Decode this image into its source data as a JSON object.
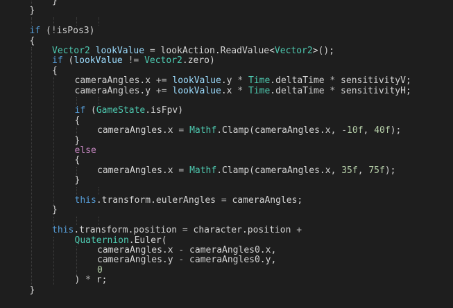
{
  "editor": {
    "language": "C#",
    "theme_colors": {
      "background": "#1e1e1e",
      "plain": "#d4d4d4",
      "keyword": "#569cd6",
      "type": "#4ec9b0",
      "variable": "#9cdcfe",
      "number": "#b5cea8",
      "operator": "#b4b4b4",
      "control": "#c586c0",
      "indent_guide": "#404040"
    },
    "lines": [
      {
        "indent": 2,
        "tokens": [
          {
            "t": "}",
            "c": "p"
          }
        ]
      },
      {
        "indent": 1,
        "tokens": [
          {
            "t": "}",
            "c": "p"
          }
        ]
      },
      {
        "indent": 0,
        "tokens": []
      },
      {
        "indent": 1,
        "tokens": [
          {
            "t": "if",
            "c": "kw"
          },
          {
            "t": " (",
            "c": "p"
          },
          {
            "t": "!",
            "c": "op"
          },
          {
            "t": "isPos3",
            "c": "p"
          },
          {
            "t": ")",
            "c": "p"
          }
        ]
      },
      {
        "indent": 1,
        "tokens": [
          {
            "t": "{",
            "c": "p"
          }
        ]
      },
      {
        "indent": 2,
        "tokens": [
          {
            "t": "Vector2",
            "c": "ty"
          },
          {
            "t": " ",
            "c": "p"
          },
          {
            "t": "lookValue",
            "c": "va"
          },
          {
            "t": " ",
            "c": "p"
          },
          {
            "t": "=",
            "c": "op"
          },
          {
            "t": " lookAction.ReadValue<",
            "c": "p"
          },
          {
            "t": "Vector2",
            "c": "ty"
          },
          {
            "t": ">();",
            "c": "p"
          }
        ]
      },
      {
        "indent": 2,
        "tokens": [
          {
            "t": "if",
            "c": "kw"
          },
          {
            "t": " (",
            "c": "p"
          },
          {
            "t": "lookValue",
            "c": "va"
          },
          {
            "t": " ",
            "c": "p"
          },
          {
            "t": "!=",
            "c": "op"
          },
          {
            "t": " ",
            "c": "p"
          },
          {
            "t": "Vector2",
            "c": "ty"
          },
          {
            "t": ".zero)",
            "c": "p"
          }
        ]
      },
      {
        "indent": 2,
        "tokens": [
          {
            "t": "{",
            "c": "p"
          }
        ]
      },
      {
        "indent": 3,
        "tokens": [
          {
            "t": "cameraAngles.x ",
            "c": "p"
          },
          {
            "t": "+=",
            "c": "op"
          },
          {
            "t": " ",
            "c": "p"
          },
          {
            "t": "lookValue",
            "c": "va"
          },
          {
            "t": ".y ",
            "c": "p"
          },
          {
            "t": "*",
            "c": "op"
          },
          {
            "t": " ",
            "c": "p"
          },
          {
            "t": "Time",
            "c": "ty"
          },
          {
            "t": ".deltaTime ",
            "c": "p"
          },
          {
            "t": "*",
            "c": "op"
          },
          {
            "t": " sensitivityV;",
            "c": "p"
          }
        ]
      },
      {
        "indent": 3,
        "tokens": [
          {
            "t": "cameraAngles.y ",
            "c": "p"
          },
          {
            "t": "+=",
            "c": "op"
          },
          {
            "t": " ",
            "c": "p"
          },
          {
            "t": "lookValue",
            "c": "va"
          },
          {
            "t": ".x ",
            "c": "p"
          },
          {
            "t": "*",
            "c": "op"
          },
          {
            "t": " ",
            "c": "p"
          },
          {
            "t": "Time",
            "c": "ty"
          },
          {
            "t": ".deltaTime ",
            "c": "p"
          },
          {
            "t": "*",
            "c": "op"
          },
          {
            "t": " sensitivityH;",
            "c": "p"
          }
        ]
      },
      {
        "indent": 0,
        "tokens": []
      },
      {
        "indent": 3,
        "tokens": [
          {
            "t": "if",
            "c": "kw"
          },
          {
            "t": " (",
            "c": "p"
          },
          {
            "t": "GameState",
            "c": "ty"
          },
          {
            "t": ".isFpv)",
            "c": "p"
          }
        ]
      },
      {
        "indent": 3,
        "tokens": [
          {
            "t": "{",
            "c": "p"
          }
        ]
      },
      {
        "indent": 4,
        "tokens": [
          {
            "t": "cameraAngles.x ",
            "c": "p"
          },
          {
            "t": "=",
            "c": "op"
          },
          {
            "t": " ",
            "c": "p"
          },
          {
            "t": "Mathf",
            "c": "ty"
          },
          {
            "t": ".Clamp(cameraAngles.x, ",
            "c": "p"
          },
          {
            "t": "-",
            "c": "op"
          },
          {
            "t": "10f",
            "c": "nu"
          },
          {
            "t": ", ",
            "c": "p"
          },
          {
            "t": "40f",
            "c": "nu"
          },
          {
            "t": ");",
            "c": "p"
          }
        ]
      },
      {
        "indent": 3,
        "tokens": [
          {
            "t": "}",
            "c": "p"
          }
        ]
      },
      {
        "indent": 3,
        "tokens": [
          {
            "t": "else",
            "c": "sc"
          }
        ]
      },
      {
        "indent": 3,
        "tokens": [
          {
            "t": "{",
            "c": "p"
          }
        ]
      },
      {
        "indent": 4,
        "tokens": [
          {
            "t": "cameraAngles.x ",
            "c": "p"
          },
          {
            "t": "=",
            "c": "op"
          },
          {
            "t": " ",
            "c": "p"
          },
          {
            "t": "Mathf",
            "c": "ty"
          },
          {
            "t": ".Clamp(cameraAngles.x, ",
            "c": "p"
          },
          {
            "t": "35f",
            "c": "nu"
          },
          {
            "t": ", ",
            "c": "p"
          },
          {
            "t": "75f",
            "c": "nu"
          },
          {
            "t": ");",
            "c": "p"
          }
        ]
      },
      {
        "indent": 3,
        "tokens": [
          {
            "t": "}",
            "c": "p"
          }
        ]
      },
      {
        "indent": 0,
        "tokens": []
      },
      {
        "indent": 3,
        "tokens": [
          {
            "t": "this",
            "c": "kw"
          },
          {
            "t": ".transform.eulerAngles ",
            "c": "p"
          },
          {
            "t": "=",
            "c": "op"
          },
          {
            "t": " cameraAngles;",
            "c": "p"
          }
        ]
      },
      {
        "indent": 2,
        "tokens": [
          {
            "t": "}",
            "c": "p"
          }
        ]
      },
      {
        "indent": 0,
        "tokens": []
      },
      {
        "indent": 2,
        "tokens": [
          {
            "t": "this",
            "c": "kw"
          },
          {
            "t": ".transform.position ",
            "c": "p"
          },
          {
            "t": "=",
            "c": "op"
          },
          {
            "t": " character.position ",
            "c": "p"
          },
          {
            "t": "+",
            "c": "op"
          }
        ]
      },
      {
        "indent": 3,
        "tokens": [
          {
            "t": "Quaternion",
            "c": "ty"
          },
          {
            "t": ".Euler(",
            "c": "p"
          }
        ]
      },
      {
        "indent": 4,
        "tokens": [
          {
            "t": "cameraAngles.x ",
            "c": "p"
          },
          {
            "t": "-",
            "c": "op"
          },
          {
            "t": " cameraAngles0.x,",
            "c": "p"
          }
        ]
      },
      {
        "indent": 4,
        "tokens": [
          {
            "t": "cameraAngles.y ",
            "c": "p"
          },
          {
            "t": "-",
            "c": "op"
          },
          {
            "t": " cameraAngles0.y,",
            "c": "p"
          }
        ]
      },
      {
        "indent": 4,
        "tokens": [
          {
            "t": "0",
            "c": "nu"
          }
        ]
      },
      {
        "indent": 3,
        "tokens": [
          {
            "t": ") ",
            "c": "p"
          },
          {
            "t": "*",
            "c": "op"
          },
          {
            "t": " r;",
            "c": "p"
          }
        ]
      },
      {
        "indent": 1,
        "tokens": [
          {
            "t": "}",
            "c": "p"
          }
        ]
      }
    ]
  }
}
